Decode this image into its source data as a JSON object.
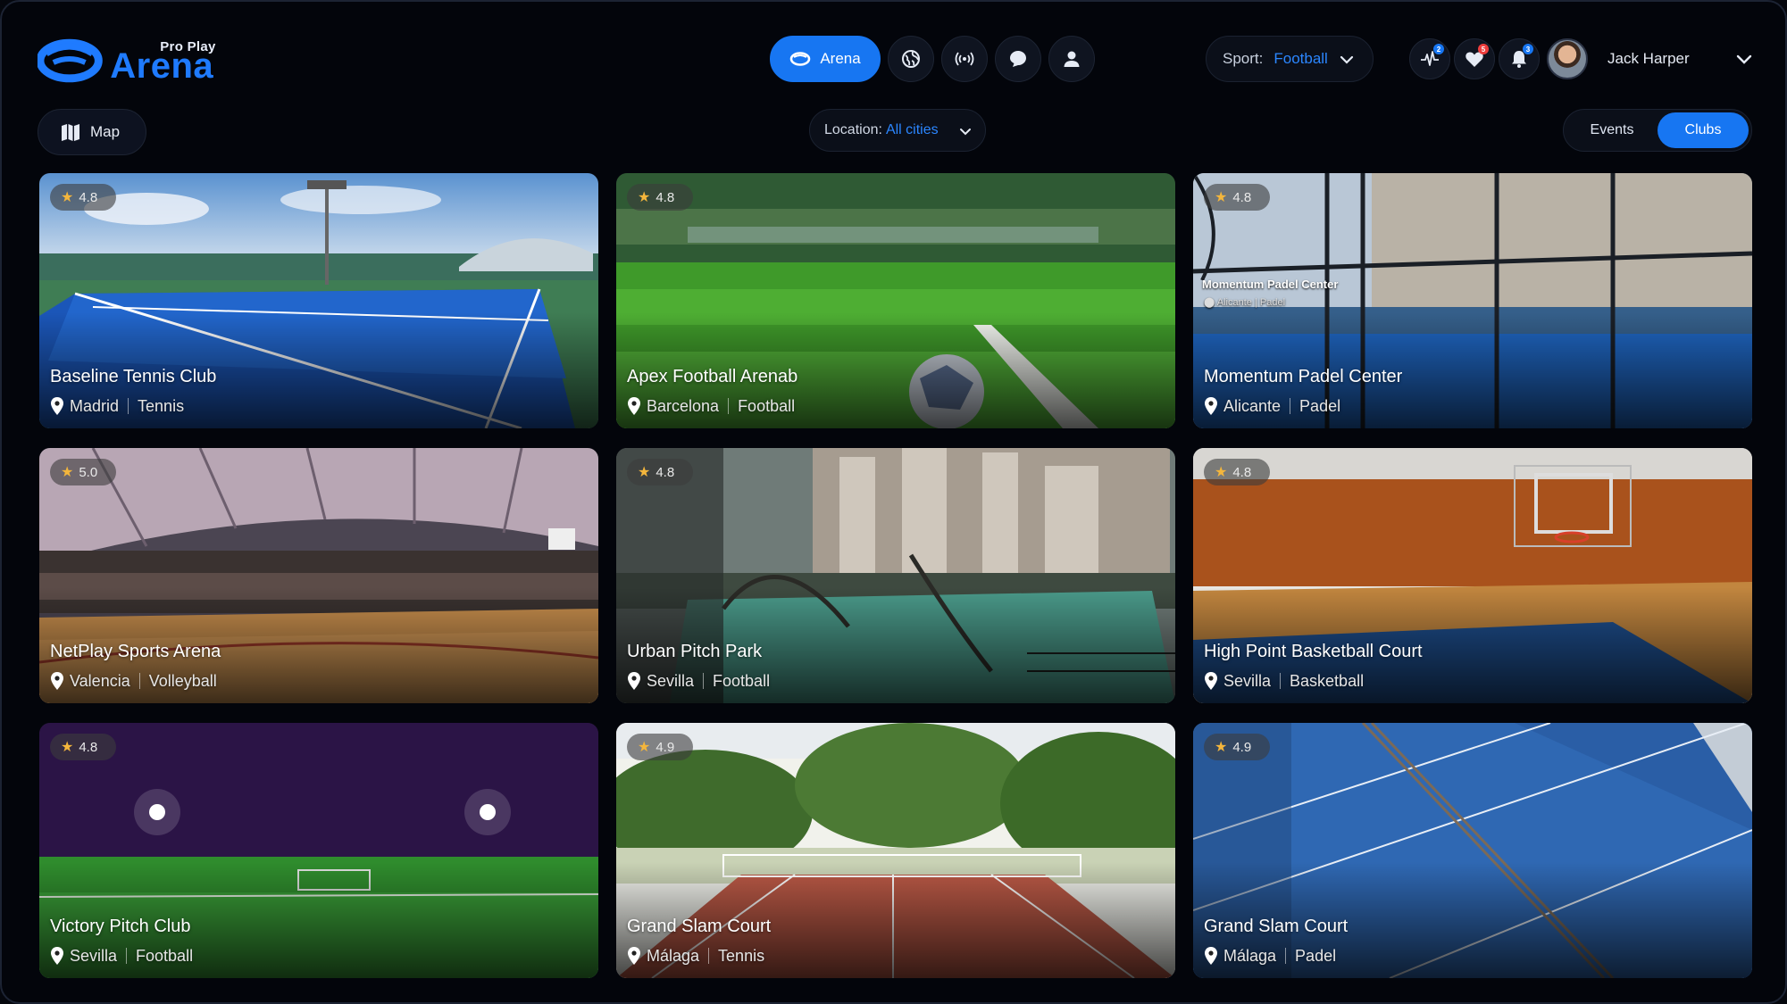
{
  "brand": {
    "small": "Pro Play",
    "big": "Arena"
  },
  "nav": {
    "active_label": "Arena",
    "icons": [
      "arena-icon",
      "globe-icon",
      "broadcast-icon",
      "chat-icon",
      "user-icon"
    ]
  },
  "sport_filter": {
    "label": "Sport:",
    "value": "Football"
  },
  "user": {
    "name": "Jack Harper",
    "activity_badge": "2",
    "favorites_badge": "5",
    "notifications_badge": "3"
  },
  "map_button": {
    "label": "Map"
  },
  "location_filter": {
    "label": "Location:",
    "value": "All cities"
  },
  "view_toggle": {
    "events": "Events",
    "clubs": "Clubs",
    "active": "Clubs"
  },
  "cards": [
    {
      "rating": "4.8",
      "title": "Baseline Tennis Club",
      "city": "Madrid",
      "sport": "Tennis"
    },
    {
      "rating": "4.8",
      "title": "Apex Football Arenab",
      "city": "Barcelona",
      "sport": "Football"
    },
    {
      "rating": "4.8",
      "title": "Momentum Padel Center",
      "city": "Alicante",
      "sport": "Padel",
      "sign_title": "Momentum Padel Center",
      "sign_city": "Alicante",
      "sign_sport": "Padel"
    },
    {
      "rating": "5.0",
      "title": "NetPlay Sports Arena",
      "city": "Valencia",
      "sport": "Volleyball"
    },
    {
      "rating": "4.8",
      "title": "Urban Pitch Park",
      "city": "Sevilla",
      "sport": "Football"
    },
    {
      "rating": "4.8",
      "title": "High Point Basketball Court",
      "city": "Sevilla",
      "sport": "Basketball"
    },
    {
      "rating": "4.8",
      "title": "Victory Pitch Club",
      "city": "Sevilla",
      "sport": "Football"
    },
    {
      "rating": "4.9",
      "title": "Grand Slam Court",
      "city": "Málaga",
      "sport": "Tennis"
    },
    {
      "rating": "4.9",
      "title": "Grand Slam Court",
      "city": "Málaga",
      "sport": "Padel"
    }
  ],
  "colors": {
    "accent": "#1776f2",
    "background": "#03050b",
    "star": "#f4b63c",
    "badge_red": "#ee3d3d"
  }
}
